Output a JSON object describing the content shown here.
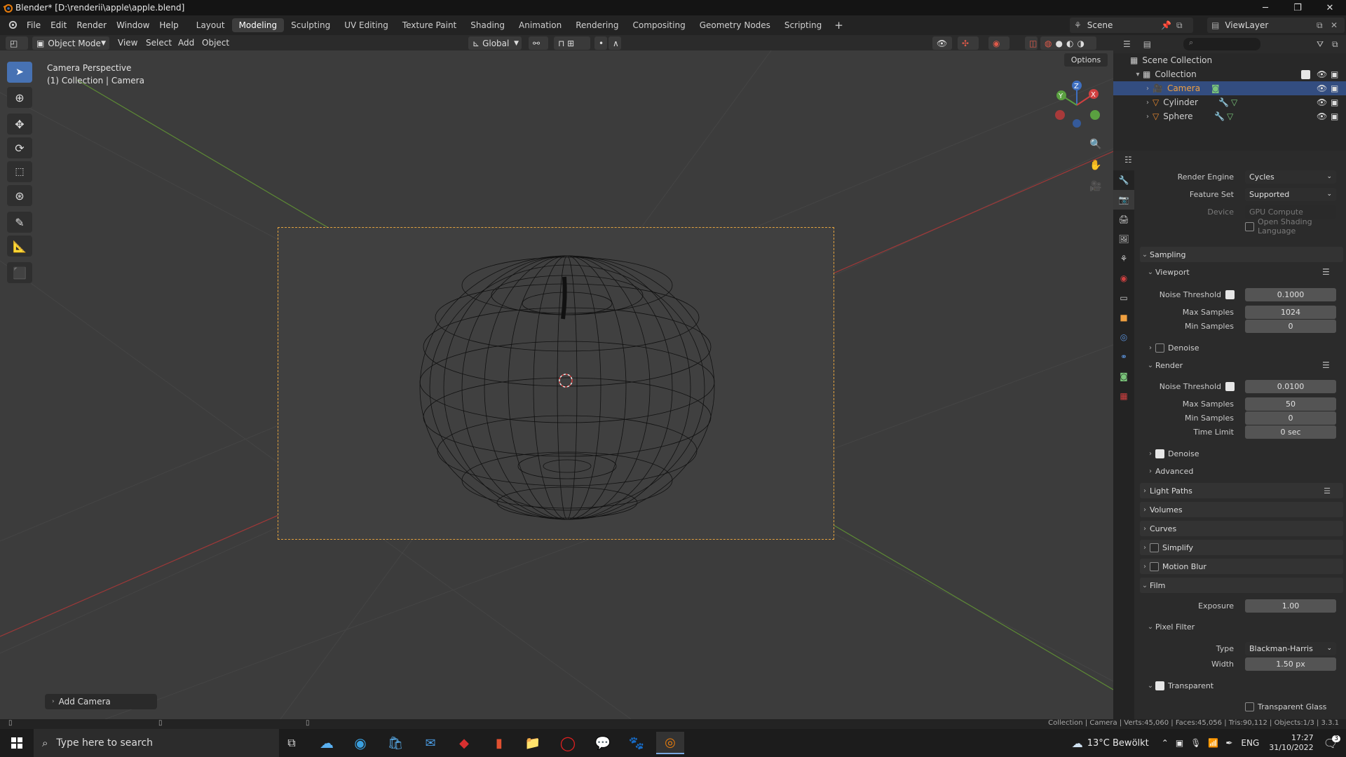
{
  "window": {
    "title": "Blender* [D:\\renderii\\apple\\apple.blend]"
  },
  "menu": [
    "File",
    "Edit",
    "Render",
    "Window",
    "Help"
  ],
  "workspaces": [
    "Layout",
    "Modeling",
    "Sculpting",
    "UV Editing",
    "Texture Paint",
    "Shading",
    "Animation",
    "Rendering",
    "Compositing",
    "Geometry Nodes",
    "Scripting"
  ],
  "active_workspace": "Modeling",
  "scene": {
    "name": "Scene",
    "view_layer": "ViewLayer"
  },
  "viewport_header": {
    "mode": "Object Mode",
    "menus": [
      "View",
      "Select",
      "Add",
      "Object"
    ],
    "orientation": "Global",
    "options": "Options"
  },
  "viewport": {
    "camera_label": "Camera Perspective",
    "collection_label": "(1) Collection | Camera",
    "add_camera": "Add Camera",
    "gizmo": {
      "x": "X",
      "y": "Y",
      "z": "Z"
    }
  },
  "outliner": {
    "root": "Scene Collection",
    "collection": "Collection",
    "items": [
      {
        "name": "Camera",
        "selected": true,
        "color": "#f0a040"
      },
      {
        "name": "Cylinder",
        "selected": false,
        "color": "#e88a30"
      },
      {
        "name": "Sphere",
        "selected": false,
        "color": "#e88a30"
      }
    ]
  },
  "properties": {
    "render_engine_label": "Render Engine",
    "render_engine": "Cycles",
    "feature_set_label": "Feature Set",
    "feature_set": "Supported",
    "device_label": "Device",
    "device": "GPU Compute",
    "osl_label": "Open Shading Language",
    "sampling": "Sampling",
    "viewport": "Viewport",
    "noise_threshold_label": "Noise Threshold",
    "vp_noise_threshold": "0.1000",
    "max_samples_label": "Max Samples",
    "vp_max_samples": "1024",
    "min_samples_label": "Min Samples",
    "vp_min_samples": "0",
    "denoise": "Denoise",
    "render": "Render",
    "r_noise_threshold": "0.0100",
    "r_max_samples": "50",
    "r_min_samples": "0",
    "time_limit_label": "Time Limit",
    "r_time_limit": "0 sec",
    "advanced": "Advanced",
    "light_paths": "Light Paths",
    "volumes": "Volumes",
    "curves": "Curves",
    "simplify": "Simplify",
    "motion_blur": "Motion Blur",
    "film": "Film",
    "exposure_label": "Exposure",
    "exposure": "1.00",
    "pixel_filter": "Pixel Filter",
    "type_label": "Type",
    "filter_type": "Blackman-Harris",
    "width_label": "Width",
    "filter_width": "1.50 px",
    "transparent": "Transparent",
    "transparent_glass": "Transparent Glass"
  },
  "statusbar": {
    "info": "Collection | Camera | Verts:45,060 | Faces:45,056 | Tris:90,112 | Objects:1/3 | 3.3.1"
  },
  "taskbar": {
    "search_placeholder": "Type here to search",
    "weather": "13°C  Bewölkt",
    "lang": "ENG",
    "time": "17:27",
    "date": "31/10/2022",
    "notif_count": "3"
  },
  "colors": {
    "accent": "#4772b3",
    "selection": "#334d80",
    "camera_frame": "#e3a23e",
    "x_axis": "#c04040",
    "y_axis": "#70a040"
  }
}
